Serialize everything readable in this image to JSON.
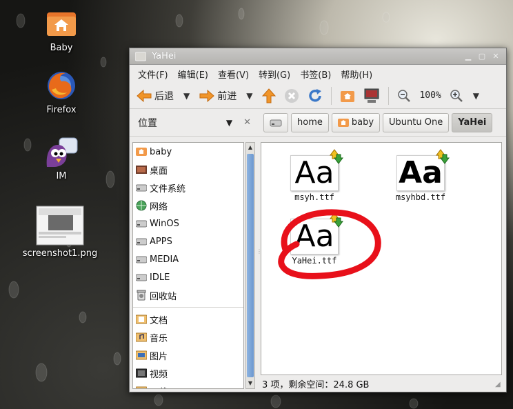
{
  "desktop": {
    "icons": [
      {
        "label": "Baby",
        "icon": "home-folder-icon"
      },
      {
        "label": "Firefox",
        "icon": "firefox-icon"
      },
      {
        "label": "IM",
        "icon": "pidgin-icon"
      },
      {
        "label": "screenshot1.png",
        "icon": "image-file-icon"
      }
    ]
  },
  "window": {
    "title": "YaHei",
    "menu": [
      "文件(F)",
      "编辑(E)",
      "查看(V)",
      "转到(G)",
      "书签(B)",
      "帮助(H)"
    ],
    "toolbar": {
      "back": "后退",
      "forward": "前进",
      "zoom": "100%"
    },
    "sidebar": {
      "header": "位置",
      "places": [
        {
          "label": "baby",
          "icon": "home-folder-icon"
        },
        {
          "label": "桌面",
          "icon": "desktop-icon"
        },
        {
          "label": "文件系统",
          "icon": "drive-icon"
        },
        {
          "label": "网络",
          "icon": "network-icon"
        },
        {
          "label": "WinOS",
          "icon": "drive-icon"
        },
        {
          "label": "APPS",
          "icon": "drive-icon"
        },
        {
          "label": "MEDIA",
          "icon": "drive-icon"
        },
        {
          "label": "IDLE",
          "icon": "drive-icon"
        },
        {
          "label": "回收站",
          "icon": "trash-icon"
        }
      ],
      "bookmarks": [
        {
          "label": "文档",
          "icon": "documents-folder-icon"
        },
        {
          "label": "音乐",
          "icon": "music-folder-icon"
        },
        {
          "label": "图片",
          "icon": "pictures-folder-icon"
        },
        {
          "label": "视频",
          "icon": "videos-folder-icon"
        },
        {
          "label": "下载",
          "icon": "downloads-folder-icon"
        }
      ]
    },
    "breadcrumbs": [
      "home",
      "baby",
      "Ubuntu One",
      "YaHei"
    ],
    "files": [
      {
        "name": "msyh.ttf",
        "preview": "Aa"
      },
      {
        "name": "msyhbd.ttf",
        "preview": "Aa"
      },
      {
        "name": "YaHei.ttf",
        "preview": "Aa"
      }
    ],
    "status": "3 项，剩余空间：24.8 GB"
  },
  "colors": {
    "highlight_circle": "#e8101a",
    "accent_blue": "#3b78c8"
  }
}
